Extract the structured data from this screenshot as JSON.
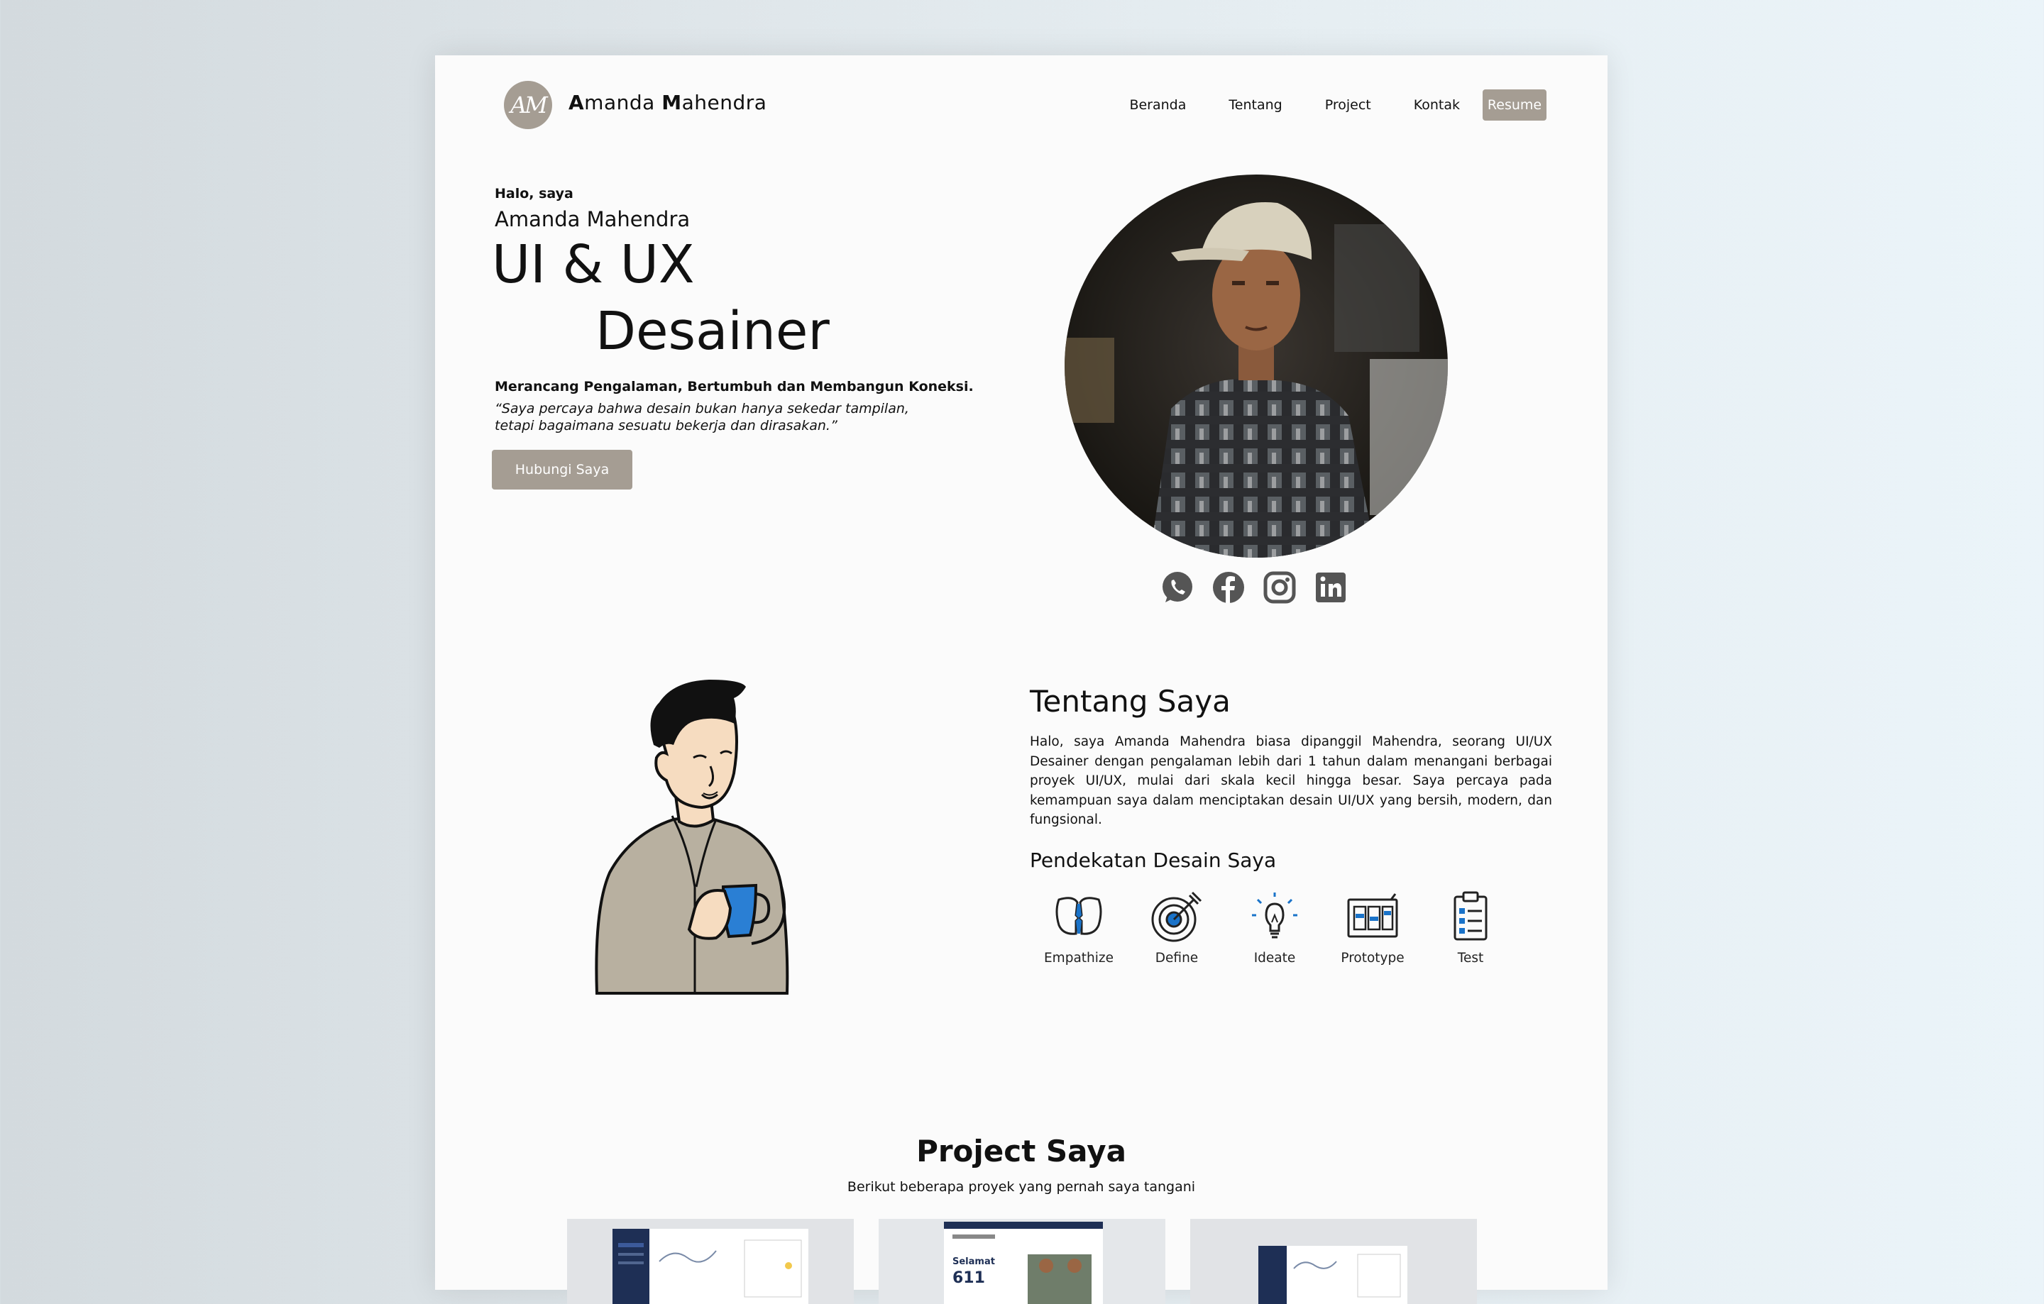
{
  "brand": {
    "logo_text": "AM",
    "name_first_initial": "A",
    "name_first_rest": "manda ",
    "name_last_initial": "M",
    "name_last_rest": "ahendra"
  },
  "nav": {
    "items": [
      "Beranda",
      "Tentang",
      "Project",
      "Kontak"
    ],
    "resume_label": "Resume"
  },
  "hero": {
    "greeting": "Halo, saya",
    "name": "Amanda Mahendra",
    "title_line1": "UI & UX",
    "title_line2": "Desainer",
    "tagline": "Merancang Pengalaman, Bertumbuh dan Membangun Koneksi.",
    "quote": "“Saya percaya bahwa desain bukan hanya sekedar tampilan, tetapi bagaimana sesuatu bekerja dan dirasakan.”",
    "cta_label": "Hubungi Saya"
  },
  "socials": [
    "whatsapp-icon",
    "facebook-icon",
    "instagram-icon",
    "linkedin-icon"
  ],
  "about": {
    "title": "Tentang Saya",
    "text": "Halo, saya Amanda Mahendra biasa dipanggil Mahendra, seorang UI/UX Desainer dengan pengalaman lebih dari 1 tahun dalam menangani berbagai proyek UI/UX, mulai dari skala kecil hingga besar. Saya percaya pada kemampuan saya dalam menciptakan desain UI/UX yang bersih, modern, dan fungsional.",
    "approach_title": "Pendekatan Desain Saya",
    "steps": [
      {
        "label": "Empathize",
        "icon": "empathize-icon"
      },
      {
        "label": "Define",
        "icon": "target-icon"
      },
      {
        "label": "Ideate",
        "icon": "lightbulb-icon"
      },
      {
        "label": "Prototype",
        "icon": "prototype-icon"
      },
      {
        "label": "Test",
        "icon": "clipboard-icon"
      }
    ]
  },
  "projects": {
    "title": "Project Saya",
    "subtitle": "Berikut beberapa proyek yang pernah saya tangani"
  },
  "colors": {
    "accent": "#a59d93",
    "icon_dark": "#555555",
    "icon_blue": "#1a73c9",
    "shirt": "#b8b0a0",
    "cup": "#2a7fd4"
  }
}
